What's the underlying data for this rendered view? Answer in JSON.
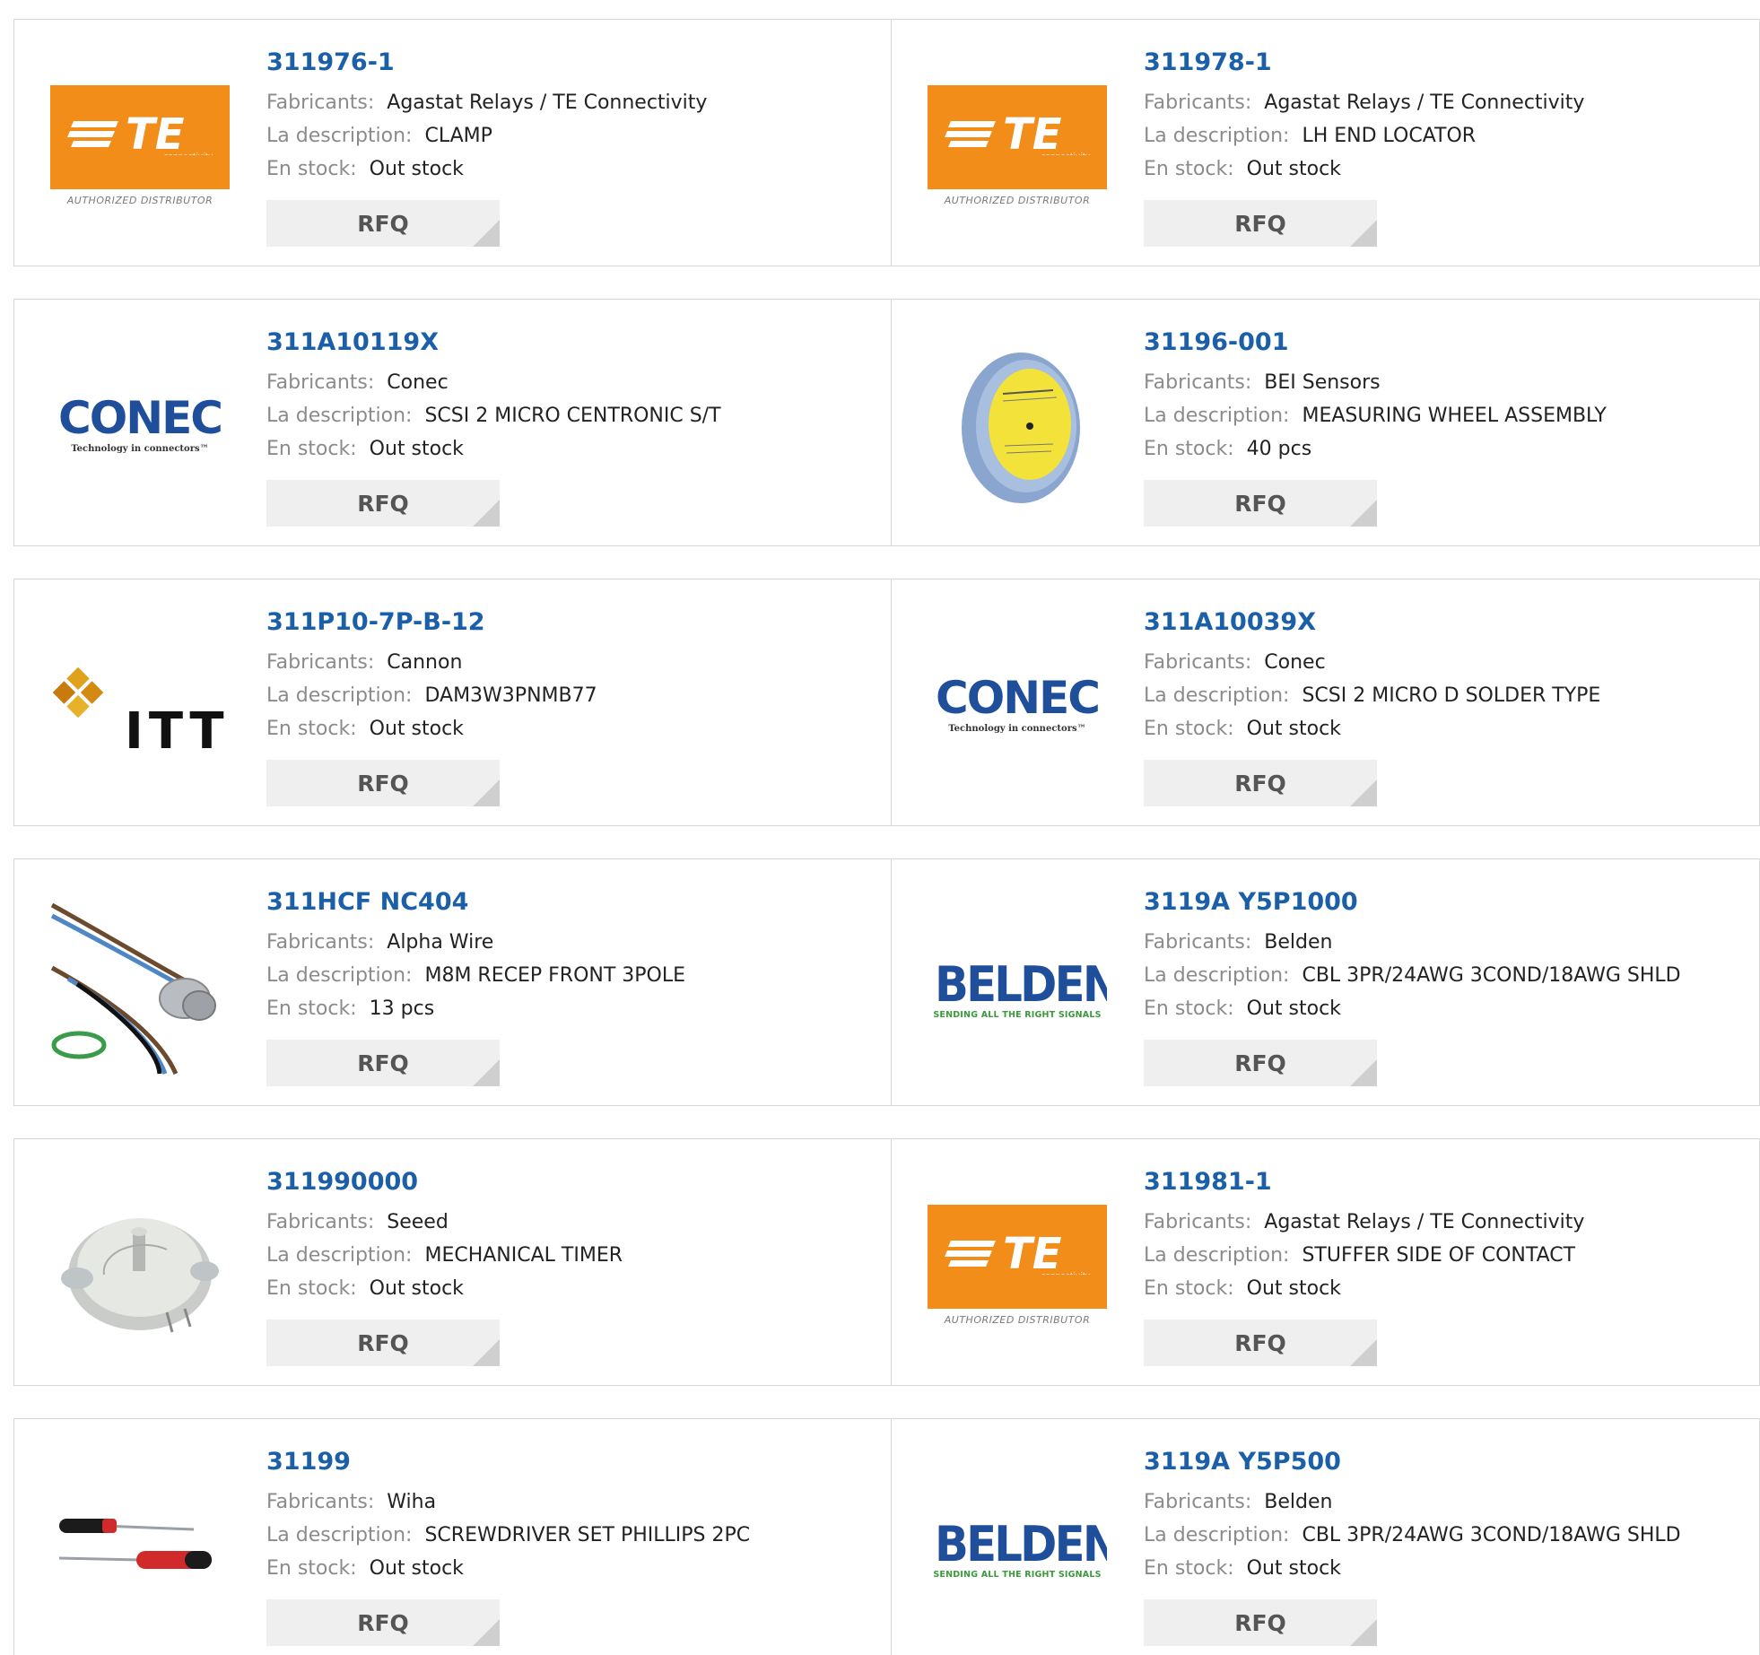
{
  "labels": {
    "manufacturer": "Fabricants:",
    "description": "La description:",
    "stock": "En stock:",
    "rfq": "RFQ"
  },
  "logo_text": {
    "te": "TE",
    "te_sub": "connectivity",
    "te_auth": "AUTHORIZED DISTRIBUTOR",
    "conec": "CONEC",
    "conec_tag": "Technology in connectors™",
    "itt": "ITT",
    "belden": "BELDEN",
    "belden_tag": "SENDING ALL THE RIGHT SIGNALS"
  },
  "products": [
    {
      "part": "311976-1",
      "manufacturer": "Agastat Relays / TE Connectivity",
      "description": "CLAMP",
      "stock": "Out stock",
      "image": "te-logo"
    },
    {
      "part": "311978-1",
      "manufacturer": "Agastat Relays / TE Connectivity",
      "description": "LH END LOCATOR",
      "stock": "Out stock",
      "image": "te-logo"
    },
    {
      "part": "311A10119X",
      "manufacturer": "Conec",
      "description": "SCSI 2 MICRO CENTRONIC S/T",
      "stock": "Out stock",
      "image": "conec-logo"
    },
    {
      "part": "31196-001",
      "manufacturer": "BEI Sensors",
      "description": "MEASURING WHEEL ASSEMBLY",
      "stock": "40 pcs",
      "image": "measuring-wheel-photo"
    },
    {
      "part": "311P10-7P-B-12",
      "manufacturer": "Cannon",
      "description": "DAM3W3PNMB77",
      "stock": "Out stock",
      "image": "itt-logo"
    },
    {
      "part": "311A10039X",
      "manufacturer": "Conec",
      "description": "SCSI 2 MICRO D SOLDER TYPE",
      "stock": "Out stock",
      "image": "conec-logo"
    },
    {
      "part": "311HCF NC404",
      "manufacturer": "Alpha Wire",
      "description": "M8M RECEP FRONT 3POLE",
      "stock": "13 pcs",
      "image": "connector-photo"
    },
    {
      "part": "3119A Y5P1000",
      "manufacturer": "Belden",
      "description": "CBL 3PR/24AWG 3COND/18AWG SHLD",
      "stock": "Out stock",
      "image": "belden-logo"
    },
    {
      "part": "311990000",
      "manufacturer": "Seeed",
      "description": "MECHANICAL TIMER",
      "stock": "Out stock",
      "image": "timer-photo"
    },
    {
      "part": "311981-1",
      "manufacturer": "Agastat Relays / TE Connectivity",
      "description": "STUFFER SIDE OF CONTACT",
      "stock": "Out stock",
      "image": "te-logo"
    },
    {
      "part": "31199",
      "manufacturer": "Wiha",
      "description": "SCREWDRIVER SET PHILLIPS 2PC",
      "stock": "Out stock",
      "image": "screwdriver-photo"
    },
    {
      "part": "3119A Y5P500",
      "manufacturer": "Belden",
      "description": "CBL 3PR/24AWG 3COND/18AWG SHLD",
      "stock": "Out stock",
      "image": "belden-logo"
    }
  ],
  "colors": {
    "part_link": "#1a5fa8",
    "te_orange": "#f28d1a",
    "conec_blue": "#1f4e9a",
    "belden_blue": "#1f4e9a",
    "belden_green": "#3b9a3b"
  }
}
